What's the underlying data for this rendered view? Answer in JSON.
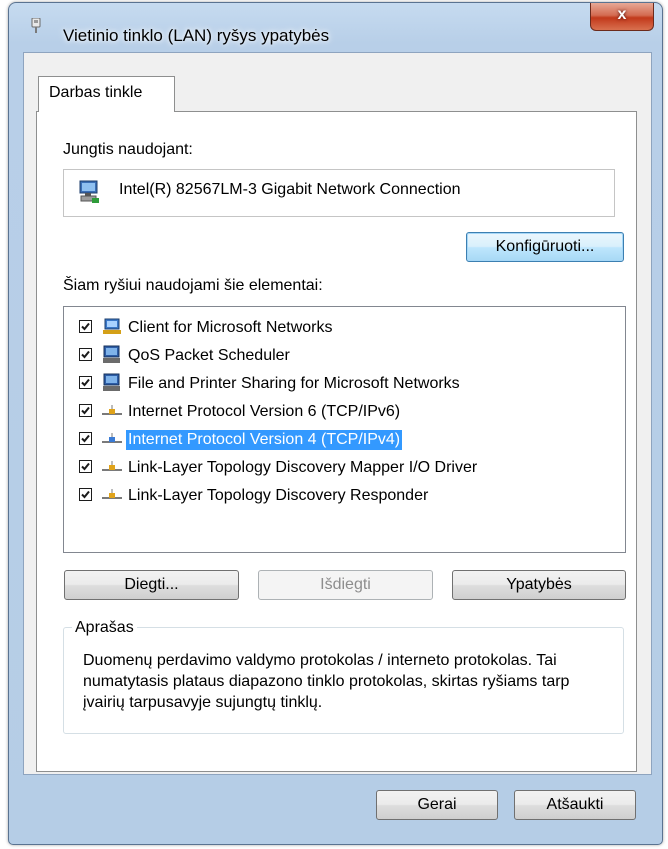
{
  "window": {
    "title": "Vietinio tinklo (LAN) ryšys ypatybės",
    "close_glyph": "x",
    "icon": "network-connection-icon"
  },
  "tabs": [
    {
      "label": "Darbas tinkle",
      "active": true
    }
  ],
  "connect_using": {
    "label": "Jungtis naudojant:",
    "adapter_name": "Intel(R) 82567LM-3 Gigabit Network Connection",
    "adapter_icon": "network-adapter-icon",
    "configure_label": "Konfigūruoti..."
  },
  "components": {
    "label": "Šiam ryšiui naudojami šie elementai:",
    "items": [
      {
        "label": "Client for Microsoft Networks",
        "checked": true,
        "icon": "network-client-icon",
        "selected": false
      },
      {
        "label": "QoS Packet Scheduler",
        "checked": true,
        "icon": "network-service-icon",
        "selected": false
      },
      {
        "label": "File and Printer Sharing for Microsoft Networks",
        "checked": true,
        "icon": "network-service-icon",
        "selected": false
      },
      {
        "label": "Internet Protocol Version 6 (TCP/IPv6)",
        "checked": true,
        "icon": "protocol-icon",
        "selected": false
      },
      {
        "label": "Internet Protocol Version 4 (TCP/IPv4)",
        "checked": true,
        "icon": "protocol-icon",
        "selected": true
      },
      {
        "label": "Link-Layer Topology Discovery Mapper I/O Driver",
        "checked": true,
        "icon": "protocol-icon",
        "selected": false
      },
      {
        "label": "Link-Layer Topology Discovery Responder",
        "checked": true,
        "icon": "protocol-icon",
        "selected": false
      }
    ]
  },
  "actions": {
    "install_label": "Diegti...",
    "uninstall_label": "Išdiegti",
    "properties_label": "Ypatybės"
  },
  "description": {
    "title": "Aprašas",
    "text": "Duomenų perdavimo valdymo protokolas / interneto protokolas. Tai numatytasis plataus diapazono tinklo protokolas, skirtas ryšiams tarp įvairių tarpusavyje sujungtų tinklų."
  },
  "footer": {
    "ok_label": "Gerai",
    "cancel_label": "Atšaukti"
  },
  "colors": {
    "selection": "#3399ff",
    "close_button": "#c2391b",
    "frame": "#b8cfe8"
  }
}
